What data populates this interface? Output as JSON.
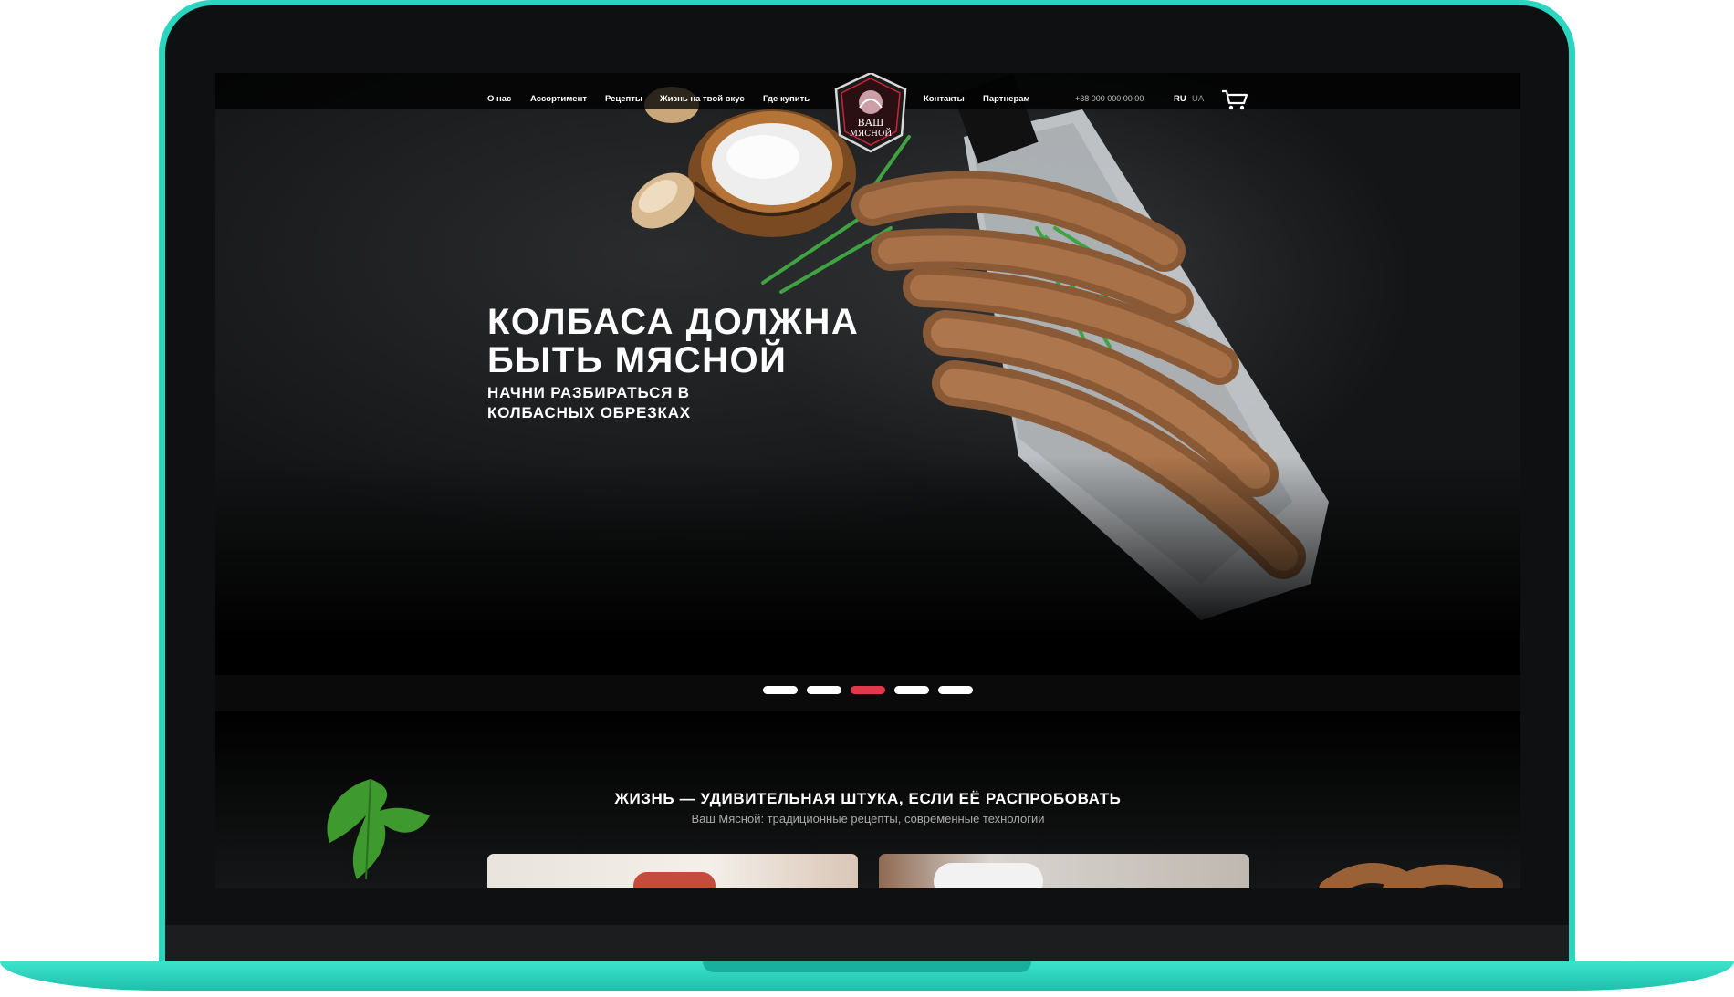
{
  "nav": {
    "items": [
      "О нас",
      "Ассортимент",
      "Рецепты",
      "Жизнь на твой вкус",
      "Где купить",
      "Контакты",
      "Партнерам"
    ],
    "phone": "+38 000 000 00 00",
    "languages": {
      "active": "RU",
      "other": "UA"
    },
    "cart_icon": "cart-icon"
  },
  "logo": {
    "line1": "ВАШ",
    "line2": "МЯСНОЙ"
  },
  "hero": {
    "title_line1": "КОЛБАСА ДОЛЖНА",
    "title_line2": "БЫТЬ МЯСНОЙ",
    "subtitle_line1": "НАЧНИ РАЗБИРАТЬСЯ В",
    "subtitle_line2": "КОЛБАСНЫХ ОБРЕЗКАХ"
  },
  "slider": {
    "count": 5,
    "active_index": 2
  },
  "section2": {
    "title": "ЖИЗНЬ — УДИВИТЕЛЬНАЯ ШТУКА, ЕСЛИ ЕЁ РАСПРОБОВАТЬ",
    "subtitle": "Ваш Мясной: традиционные рецепты, современные технологии"
  },
  "colors": {
    "device_frame": "#2ad6bf",
    "accent_red": "#e2384c",
    "background": "#0a0a0b"
  }
}
